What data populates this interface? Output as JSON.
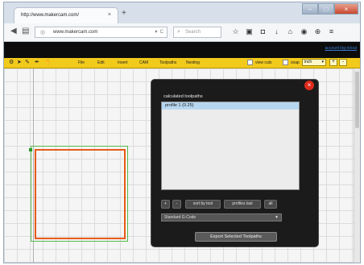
{
  "browser": {
    "tab_title": "http://www.makercam.com/",
    "tab_close": "×",
    "new_tab": "+",
    "url": "www.makercam.com",
    "search_placeholder": "Search",
    "window_controls": [
      "–",
      "□",
      "×"
    ]
  },
  "app": {
    "account_link": "account log-in/out",
    "menus": [
      "File",
      "Edit",
      "Insert",
      "CAM",
      "Toolpaths",
      "Nesting"
    ],
    "view_cuts_label": "view cuts",
    "snap_label": "snap",
    "unit": "inch",
    "zoom_in": "+",
    "zoom_out": "-"
  },
  "colors": {
    "toolbar": "#f2ca1c",
    "outer_path": "#55b84a",
    "inner_path": "#e85a1a",
    "dialog_bg": "#1b1b1b",
    "close_button": "#dd2b1c"
  },
  "dialog": {
    "title": "calculated toolpaths",
    "items": [
      "profile 1 (0.25)"
    ],
    "buttons": {
      "up": "+",
      "down": "-",
      "sort_by_tool": "sort by tool",
      "profiles_last": "profiles last",
      "all": "all"
    },
    "postprocessor": "Standard G-Code",
    "export_button": "Export Selected Toolpaths",
    "close": "×"
  }
}
